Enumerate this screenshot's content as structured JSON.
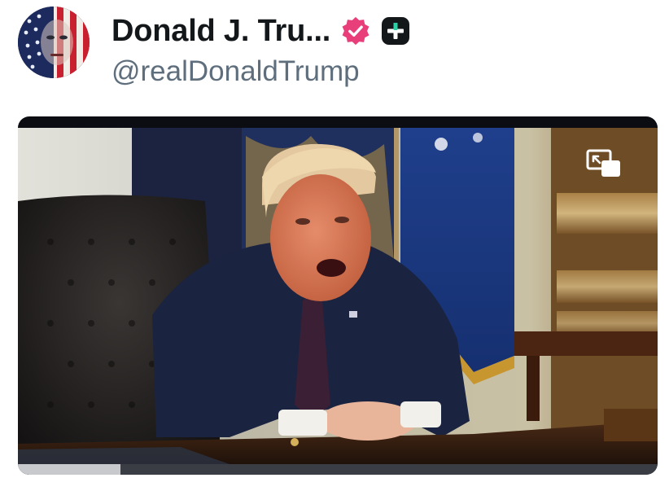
{
  "profile": {
    "display_name": "Donald J. Tru...",
    "handle": "@realDonaldTrump",
    "verified": true,
    "icons": [
      "verified-badge-icon",
      "plus-badge-icon"
    ]
  },
  "video": {
    "progress_fraction": 0.16,
    "controls": [
      "picture-in-picture-icon"
    ]
  },
  "colors": {
    "verified_pink": "#e83e7a",
    "text_primary": "#14171a",
    "text_secondary": "#5e6e7c",
    "progress_fill": "#c7c9cd",
    "progress_track": "#3a3d44"
  }
}
